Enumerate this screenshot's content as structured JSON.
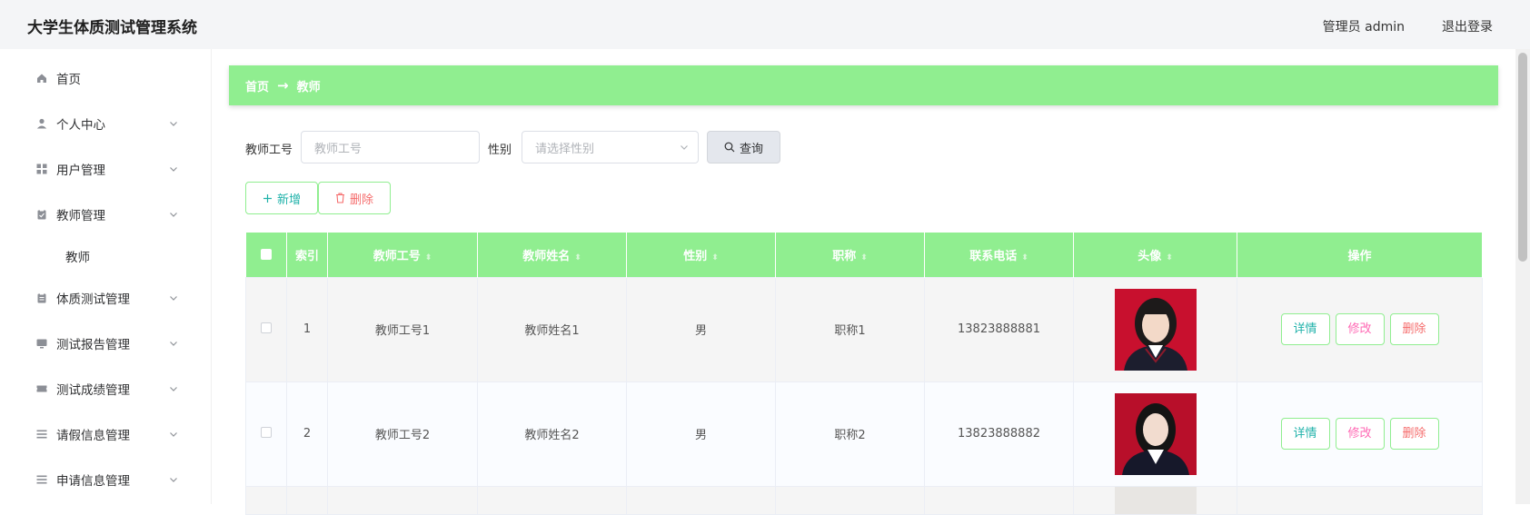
{
  "header": {
    "app_title": "大学生体质测试管理系统",
    "user_label": "管理员 admin",
    "logout_label": "退出登录"
  },
  "sidebar": {
    "items": [
      {
        "label": "首页",
        "icon": "home-icon",
        "expandable": false
      },
      {
        "label": "个人中心",
        "icon": "user-icon",
        "expandable": true
      },
      {
        "label": "用户管理",
        "icon": "grid-icon",
        "expandable": true
      },
      {
        "label": "教师管理",
        "icon": "clipboard-icon",
        "expandable": true,
        "expanded": true,
        "children": [
          "教师"
        ]
      },
      {
        "label": "体质测试管理",
        "icon": "clipboard-icon",
        "expandable": true
      },
      {
        "label": "测试报告管理",
        "icon": "monitor-icon",
        "expandable": true
      },
      {
        "label": "测试成绩管理",
        "icon": "ticket-icon",
        "expandable": true
      },
      {
        "label": "请假信息管理",
        "icon": "list-icon",
        "expandable": true
      },
      {
        "label": "申请信息管理",
        "icon": "list-icon",
        "expandable": true
      }
    ]
  },
  "breadcrumb": {
    "home": "首页",
    "arrow": "→",
    "current": "教师"
  },
  "search": {
    "teacher_no_label": "教师工号",
    "teacher_no_placeholder": "教师工号",
    "gender_label": "性别",
    "gender_placeholder": "请选择性别",
    "query_label": "查询"
  },
  "actions": {
    "add_label": "新增",
    "delete_label": "删除"
  },
  "table": {
    "columns": [
      "",
      "索引",
      "教师工号",
      "教师姓名",
      "性别",
      "职称",
      "联系电话",
      "头像",
      "操作"
    ],
    "sortable": [
      false,
      false,
      true,
      true,
      true,
      true,
      true,
      true,
      false
    ],
    "rows": [
      {
        "index": "1",
        "teacher_no": "教师工号1",
        "name": "教师姓名1",
        "gender": "男",
        "title": "职称1",
        "phone": "13823888881"
      },
      {
        "index": "2",
        "teacher_no": "教师工号2",
        "name": "教师姓名2",
        "gender": "男",
        "title": "职称2",
        "phone": "13823888882"
      }
    ],
    "row_actions": {
      "detail": "详情",
      "edit": "修改",
      "delete": "删除"
    }
  },
  "colors": {
    "accent_green": "#90ee90",
    "teal_text": "#20b2aa",
    "pink_text": "#ff69b4",
    "red_text": "#f56c6c",
    "avatar_bg": "#c8102e"
  }
}
